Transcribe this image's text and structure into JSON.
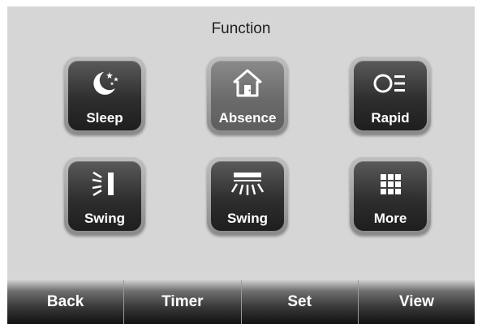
{
  "header": {
    "title": "Function"
  },
  "functions": [
    {
      "label": "Sleep",
      "icon": "moon-stars-icon"
    },
    {
      "label": "Absence",
      "icon": "house-icon",
      "active": true
    },
    {
      "label": "Rapid",
      "icon": "rapid-icon"
    },
    {
      "label": "Swing",
      "icon": "vertical-swing-icon"
    },
    {
      "label": "Swing",
      "icon": "horizontal-swing-icon"
    },
    {
      "label": "More",
      "icon": "grid-icon"
    }
  ],
  "nav": [
    {
      "label": "Back"
    },
    {
      "label": "Timer"
    },
    {
      "label": "Set"
    },
    {
      "label": "View"
    }
  ],
  "colors": {
    "panel": "#d6d6d6",
    "button_dark": "#2e2e2e",
    "button_active": "#6b6b6b",
    "text_light": "#ffffff"
  }
}
